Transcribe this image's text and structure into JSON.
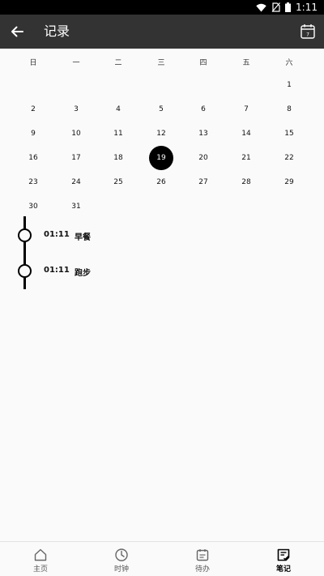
{
  "status": {
    "time": "1:11"
  },
  "appbar": {
    "title": "记录",
    "calendar_day": "7"
  },
  "calendar": {
    "weekdays": [
      "日",
      "一",
      "二",
      "三",
      "四",
      "五",
      "六"
    ],
    "weeks": [
      [
        "",
        "",
        "",
        "",
        "",
        "",
        "1"
      ],
      [
        "2",
        "3",
        "4",
        "5",
        "6",
        "7",
        "8"
      ],
      [
        "9",
        "10",
        "11",
        "12",
        "13",
        "14",
        "15"
      ],
      [
        "16",
        "17",
        "18",
        "19",
        "20",
        "21",
        "22"
      ],
      [
        "23",
        "24",
        "25",
        "26",
        "27",
        "28",
        "29"
      ],
      [
        "30",
        "31",
        "",
        "",
        "",
        "",
        ""
      ]
    ],
    "selected_day": "19"
  },
  "records": [
    {
      "time": "01:11",
      "text": "早餐"
    },
    {
      "time": "01:11",
      "text": "跑步"
    }
  ],
  "nav": {
    "items": [
      {
        "label": "主页",
        "icon": "home-icon"
      },
      {
        "label": "时钟",
        "icon": "clock-icon"
      },
      {
        "label": "待办",
        "icon": "todo-icon"
      },
      {
        "label": "笔记",
        "icon": "note-icon"
      }
    ],
    "active_index": 3
  }
}
